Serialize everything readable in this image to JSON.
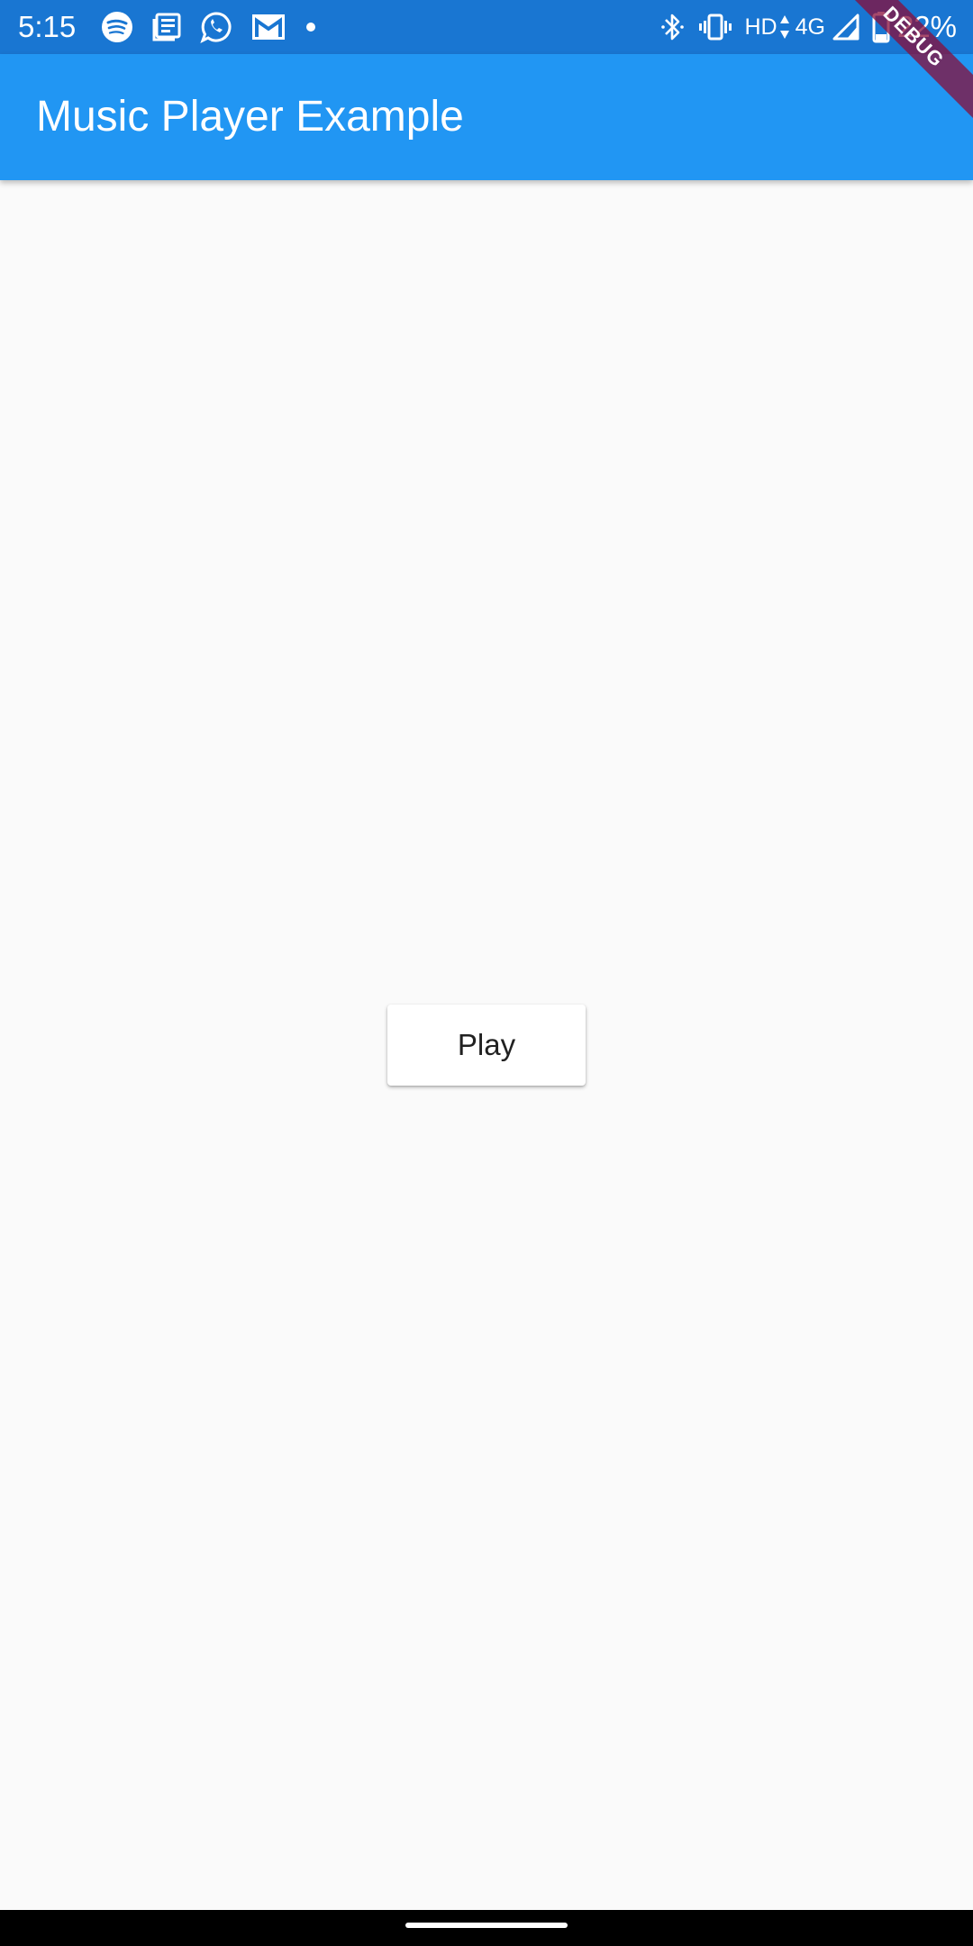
{
  "status_bar": {
    "time": "5:15",
    "left_icons": [
      "spotify-icon",
      "news-icon",
      "whatsapp-icon",
      "gmail-icon",
      "dot-icon"
    ],
    "right_icons": [
      "bluetooth-icon",
      "vibrate-icon",
      "signal-icon",
      "battery-icon"
    ],
    "network_hd": "HD",
    "network_type": "4G",
    "battery_percent": "22%",
    "color": "#1976d2"
  },
  "app_bar": {
    "title": "Music Player Example",
    "color": "#2196f3"
  },
  "debug_banner": {
    "label": "DEBUG"
  },
  "main": {
    "play_label": "Play"
  },
  "colors": {
    "background": "#fafafa",
    "primary": "#2196f3",
    "primary_dark": "#1976d2"
  }
}
